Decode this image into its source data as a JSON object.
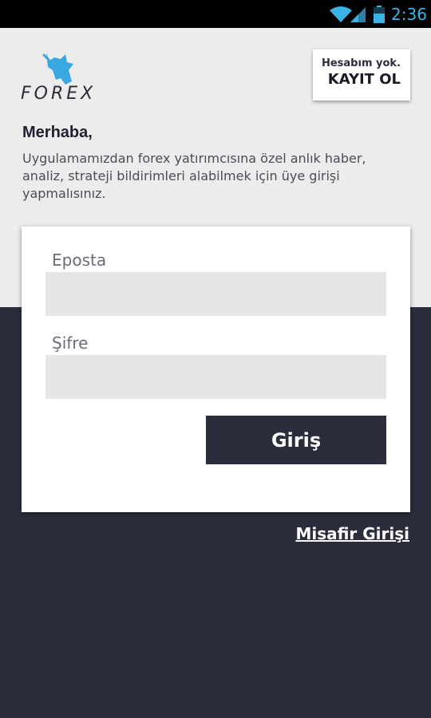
{
  "status_bar": {
    "time": "2:36",
    "icons": [
      "wifi-icon",
      "cell-signal-icon",
      "battery-icon"
    ],
    "accent": "#3ab3e6"
  },
  "brand": {
    "logo_text": "FOREX",
    "logo_icon": "bull-head-icon",
    "logo_color": "#39a7e0"
  },
  "register": {
    "note": "Hesabım yok.",
    "label": "KAYIT OL"
  },
  "greeting": {
    "title": "Merhaba,",
    "message": "Uygulamamızdan forex yatırımcısına özel anlık haber, analiz, strateji bildirimleri alabilmek için üye girişi yapmalısınız."
  },
  "login_form": {
    "email_label": "Eposta",
    "email_value": "",
    "password_label": "Şifre",
    "password_value": "",
    "submit_label": "Giriş"
  },
  "guest": {
    "label": "Misafir Girişi"
  },
  "colors": {
    "header_bg": "#ececec",
    "page_bg": "#2b2d3d",
    "button_bg": "#2b2d3d",
    "input_bg": "#e6e6e6"
  }
}
